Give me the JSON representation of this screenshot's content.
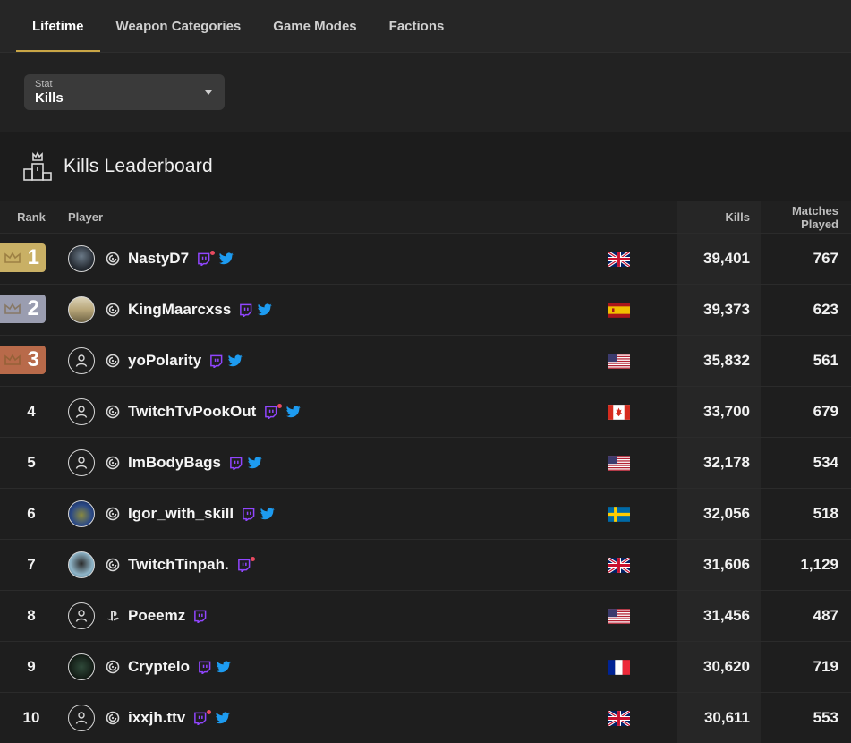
{
  "tabs": [
    {
      "label": "Lifetime",
      "active": true
    },
    {
      "label": "Weapon Categories",
      "active": false
    },
    {
      "label": "Game Modes",
      "active": false
    },
    {
      "label": "Factions",
      "active": false
    }
  ],
  "filter": {
    "label": "Stat",
    "value": "Kills"
  },
  "leaderboard": {
    "title": "Kills Leaderboard",
    "columns": {
      "rank": "Rank",
      "player": "Player",
      "kills": "Kills",
      "matches": "Matches Played"
    },
    "rows": [
      {
        "rank": "1",
        "name": "NastyD7",
        "platform": "ubisoft-icon",
        "avatar": "photo",
        "twitch": true,
        "live": true,
        "twitter": true,
        "country": "gb",
        "kills": "39,401",
        "matches": "767"
      },
      {
        "rank": "2",
        "name": "KingMaarcxss",
        "platform": "ubisoft-icon",
        "avatar": "photo",
        "twitch": true,
        "live": false,
        "twitter": true,
        "country": "es",
        "kills": "39,373",
        "matches": "623"
      },
      {
        "rank": "3",
        "name": "yoPolarity",
        "platform": "ubisoft-icon",
        "avatar": "default",
        "twitch": true,
        "live": false,
        "twitter": true,
        "country": "us",
        "kills": "35,832",
        "matches": "561"
      },
      {
        "rank": "4",
        "name": "TwitchTvPookOut",
        "platform": "ubisoft-icon",
        "avatar": "default",
        "twitch": true,
        "live": true,
        "twitter": true,
        "country": "ca",
        "kills": "33,700",
        "matches": "679"
      },
      {
        "rank": "5",
        "name": "ImBodyBags",
        "platform": "ubisoft-icon",
        "avatar": "default",
        "twitch": true,
        "live": false,
        "twitter": true,
        "country": "us",
        "kills": "32,178",
        "matches": "534"
      },
      {
        "rank": "6",
        "name": "Igor_with_skill",
        "platform": "ubisoft-icon",
        "avatar": "photo",
        "twitch": true,
        "live": false,
        "twitter": true,
        "country": "se",
        "kills": "32,056",
        "matches": "518"
      },
      {
        "rank": "7",
        "name": "TwitchTinpah.",
        "platform": "ubisoft-icon",
        "avatar": "photo",
        "twitch": true,
        "live": true,
        "twitter": false,
        "country": "gb",
        "kills": "31,606",
        "matches": "1,129"
      },
      {
        "rank": "8",
        "name": "Poeemz",
        "platform": "playstation-icon",
        "avatar": "default",
        "twitch": true,
        "live": false,
        "twitter": false,
        "country": "us",
        "kills": "31,456",
        "matches": "487"
      },
      {
        "rank": "9",
        "name": "Cryptelo",
        "platform": "ubisoft-icon",
        "avatar": "photo",
        "twitch": true,
        "live": false,
        "twitter": true,
        "country": "fr",
        "kills": "30,620",
        "matches": "719"
      },
      {
        "rank": "10",
        "name": "ixxjh.ttv",
        "platform": "ubisoft-icon",
        "avatar": "default",
        "twitch": true,
        "live": true,
        "twitter": true,
        "country": "gb",
        "kills": "30,611",
        "matches": "553"
      }
    ]
  },
  "colors": {
    "gold": "#c9b065",
    "silver": "#9a9db0",
    "bronze": "#b86a4a",
    "accent": "#c9a646",
    "twitch": "#9146ff",
    "twitter": "#1d9bf0",
    "live": "#e84a5f"
  }
}
